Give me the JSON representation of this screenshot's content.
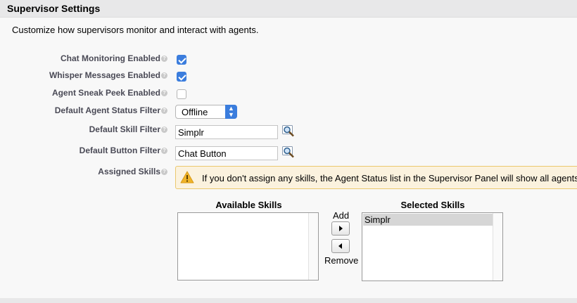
{
  "section": {
    "title": "Supervisor Settings"
  },
  "description": "Customize how supervisors monitor and interact with agents.",
  "fields": {
    "chat_monitoring": {
      "label": "Chat Monitoring Enabled",
      "checked": true
    },
    "whisper_messages": {
      "label": "Whisper Messages Enabled",
      "checked": true
    },
    "agent_sneak_peek": {
      "label": "Agent Sneak Peek Enabled",
      "checked": false
    },
    "default_agent_status": {
      "label": "Default Agent Status Filter",
      "value": "Offline"
    },
    "default_skill": {
      "label": "Default Skill Filter",
      "value": "Simplr"
    },
    "default_button": {
      "label": "Default Button Filter",
      "value": "Chat Button"
    },
    "assigned_skills": {
      "label": "Assigned Skills"
    }
  },
  "warning": {
    "text": "If you don't assign any skills, the Agent Status list in the Supervisor Panel will show all agents."
  },
  "skills": {
    "available_title": "Available Skills",
    "selected_title": "Selected Skills",
    "available": [],
    "selected": [
      "Simplr"
    ],
    "add_label": "Add",
    "remove_label": "Remove"
  },
  "help_glyph": "?",
  "colors": {
    "accent": "#3b7ddd",
    "warning_bg": "#fbf2de",
    "warning_border": "#ebc86e"
  },
  "icons": {
    "help": "help-icon",
    "lookup": "magnifier-lookup-icon",
    "warning": "warning-triangle-icon"
  }
}
